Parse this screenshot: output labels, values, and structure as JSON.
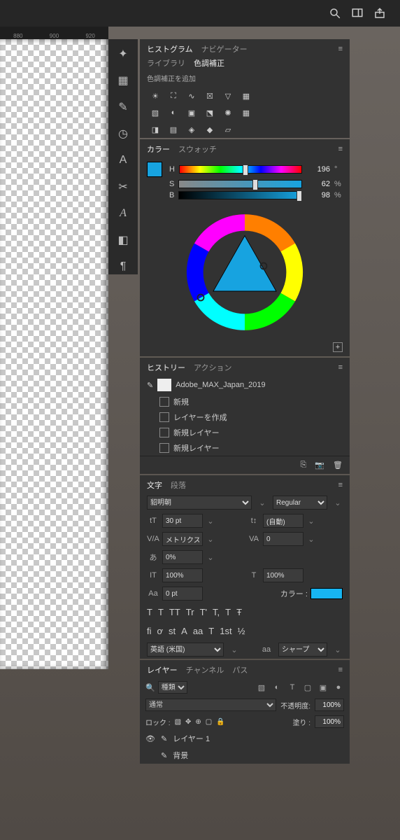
{
  "topbar": {
    "search": "search-icon",
    "workspace": "workspace-icon",
    "share": "share-icon"
  },
  "ruler": [
    "880",
    "900",
    "920"
  ],
  "tools": [
    "star-icon",
    "grid-icon",
    "brush-icon",
    "clock-icon",
    "text-icon",
    "scissors-icon",
    "font-icon",
    "cube-icon",
    "pilcrow-icon"
  ],
  "nav_panel": {
    "tabs": [
      "ヒストグラム",
      "ナビゲーター"
    ],
    "tabs2": [
      "ライブラリ",
      "色調補正"
    ],
    "sub": "色調補正を追加"
  },
  "adjust_icons_row1": [
    "brightness",
    "levels",
    "curves",
    "exposure",
    "vibrance",
    "lookup"
  ],
  "adjust_icons_row2": [
    "hue",
    "bw",
    "photo",
    "mixer",
    "color",
    "grad"
  ],
  "adjust_icons_row3": [
    "invert",
    "poster",
    "thresh",
    "map",
    "sel"
  ],
  "color_panel": {
    "tabs": [
      "カラー",
      "スウォッチ"
    ],
    "hsb": [
      {
        "label": "H",
        "value": "196",
        "unit": "°",
        "pct": 54
      },
      {
        "label": "S",
        "value": "62",
        "unit": "%",
        "pct": 62
      },
      {
        "label": "B",
        "value": "98",
        "unit": "%",
        "pct": 98
      }
    ]
  },
  "history_panel": {
    "tabs": [
      "ヒストリー",
      "アクション"
    ],
    "doc": "Adobe_MAX_Japan_2019",
    "items": [
      "新規",
      "レイヤーを作成",
      "新規レイヤー",
      "新規レイヤー"
    ]
  },
  "char_panel": {
    "tabs": [
      "文字",
      "段落"
    ],
    "font": "貂明朝",
    "style": "Regular",
    "size_label": "T",
    "size": "30 pt",
    "leading_label": "A",
    "leading": "(自動)",
    "kern_label": "V/A",
    "kern": "メトリクス",
    "track_label": "VA",
    "track": "0",
    "tsume_label": "あ",
    "tsume": "0%",
    "vscale_label": "IT",
    "vscale": "100%",
    "hscale_label": "T",
    "hscale": "100%",
    "baseline_label": "Aa",
    "baseline": "0 pt",
    "color_label": "カラー :",
    "lang": "英語 (米国)",
    "aa_label": "aa",
    "aa": "シャープ"
  },
  "text_styles": [
    "T",
    "T",
    "TT",
    "Tr",
    "T'",
    "T,",
    "T",
    "Ŧ"
  ],
  "ot_features": [
    "fi",
    "ơ",
    "st",
    "A",
    "aa",
    "T",
    "1st",
    "½"
  ],
  "layers_panel": {
    "tabs": [
      "レイヤー",
      "チャンネル",
      "パス"
    ],
    "kind_label": "種類",
    "blend": "通常",
    "opacity_label": "不透明度:",
    "opacity": "100%",
    "lock_label": "ロック :",
    "fill_label": "塗り :",
    "fill": "100%",
    "layers": [
      {
        "name": "レイヤー 1"
      },
      {
        "name": "背景"
      }
    ]
  }
}
